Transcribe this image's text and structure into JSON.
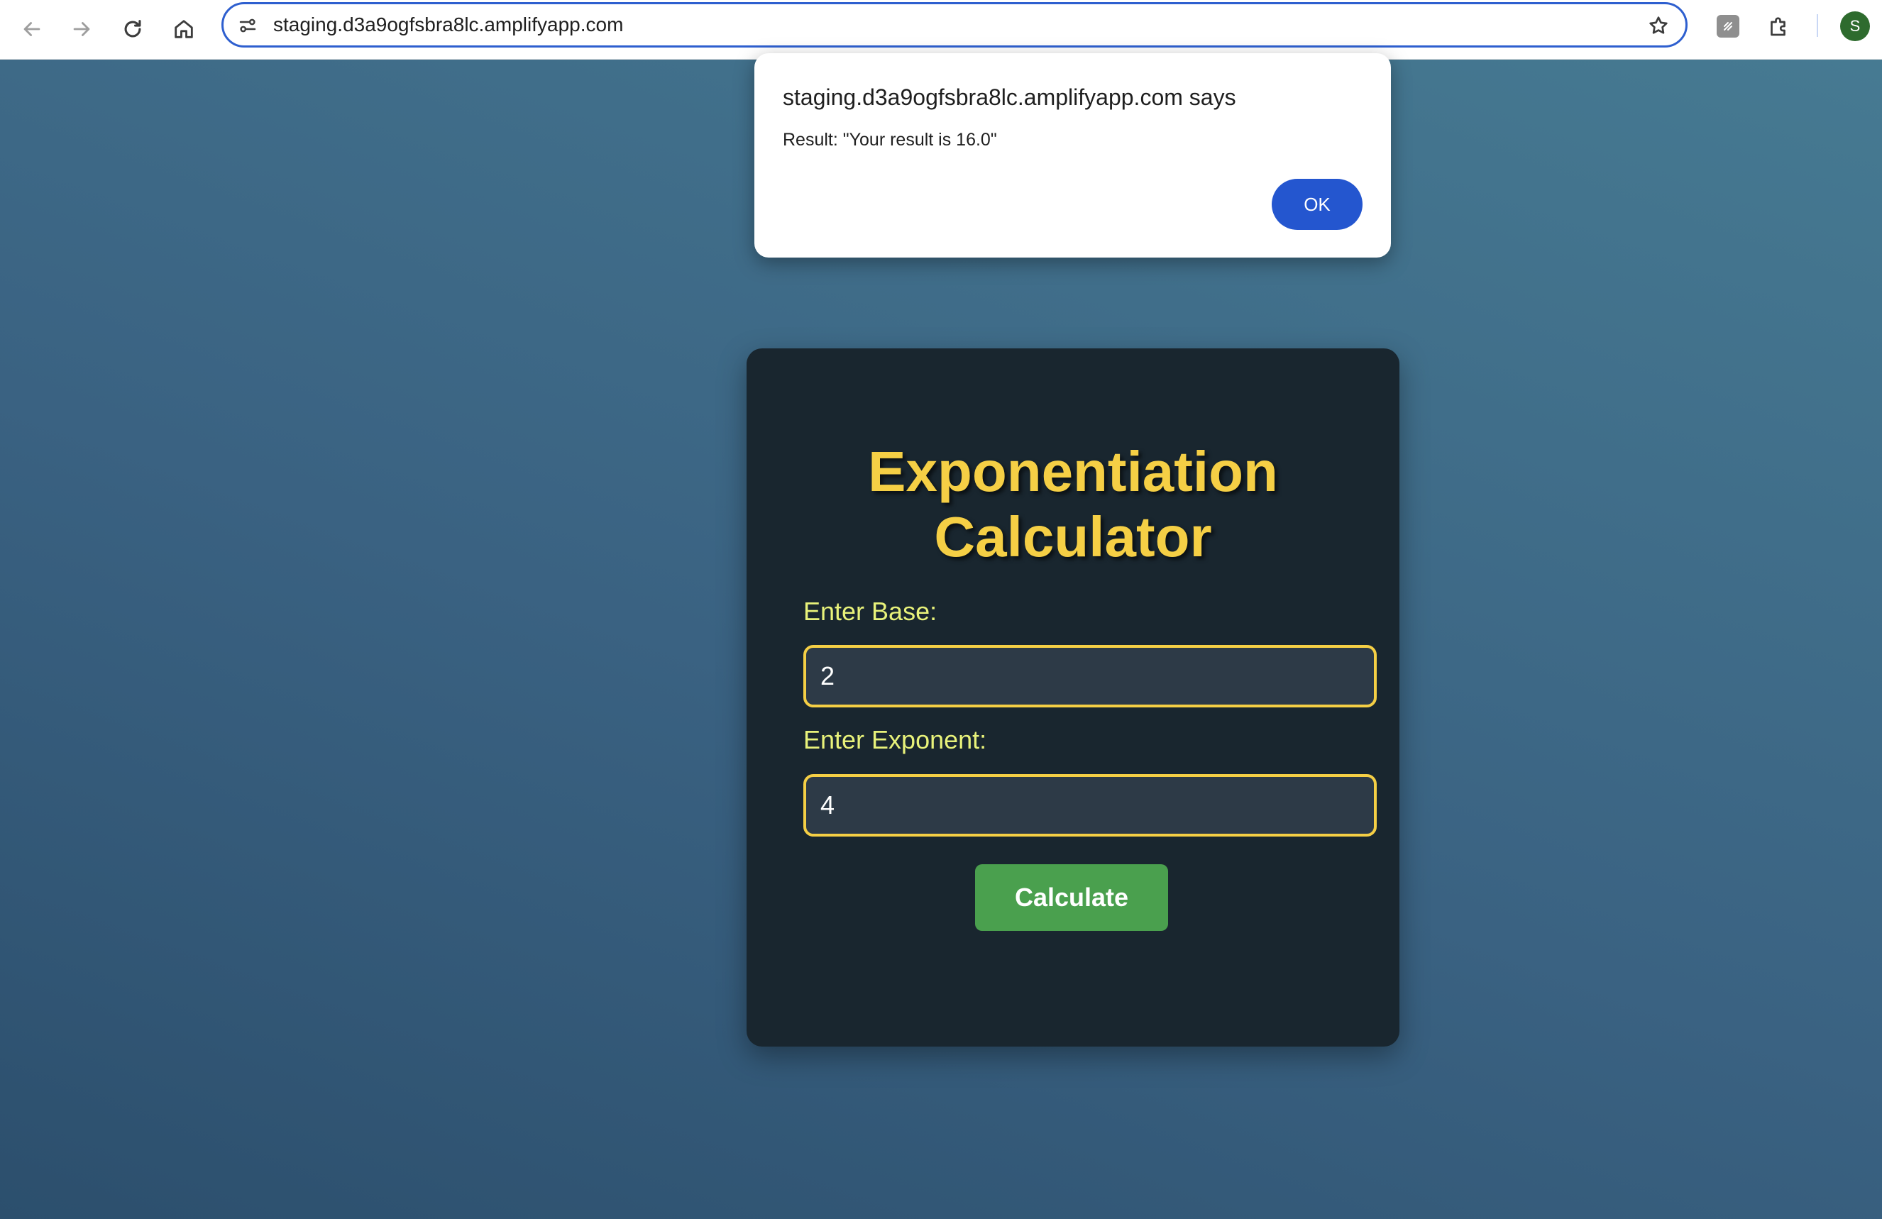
{
  "browser": {
    "url": "staging.d3a9ogfsbra8lc.amplifyapp.com",
    "profile_initial": "S",
    "icons": {
      "back": "back-arrow-icon",
      "forward": "forward-arrow-icon",
      "reload": "reload-icon",
      "home": "home-icon",
      "site_info": "site-settings-icon",
      "bookmark": "star-icon",
      "extension": "extension-puzzle-icon"
    }
  },
  "dialog": {
    "title": "staging.d3a9ogfsbra8lc.amplifyapp.com says",
    "message": "Result: \"Your result is 16.0\"",
    "ok_label": "OK"
  },
  "calculator": {
    "title": "Exponentiation Calculator",
    "base_label": "Enter Base:",
    "base_value": "2",
    "exponent_label": "Enter Exponent:",
    "exponent_value": "4",
    "calculate_label": "Calculate"
  },
  "colors": {
    "accent_yellow": "#f5cf45",
    "label_yellow": "#e8f27a",
    "button_green": "#4aa04e",
    "dialog_ok_blue": "#2456cf",
    "card_bg": "#19262f"
  }
}
